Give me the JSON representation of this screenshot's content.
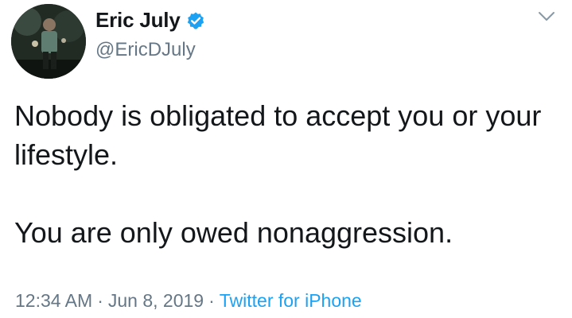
{
  "author": {
    "display_name": "Eric July",
    "handle": "@EricDJuly",
    "verified": true,
    "avatar_icon": "profile-photo"
  },
  "tweet": {
    "paragraphs": [
      "Nobody is obligated to accept you or your lifestyle.",
      "You are only owed nonaggression."
    ]
  },
  "meta": {
    "time": "12:34 AM",
    "separator": "·",
    "date": "Jun 8, 2019",
    "source": "Twitter for iPhone"
  },
  "colors": {
    "verified_badge": "#1da1f2",
    "link": "#1da1f2",
    "secondary_text": "#657786"
  },
  "icons": {
    "menu": "chevron-down-icon",
    "verified": "verified-badge-icon"
  }
}
